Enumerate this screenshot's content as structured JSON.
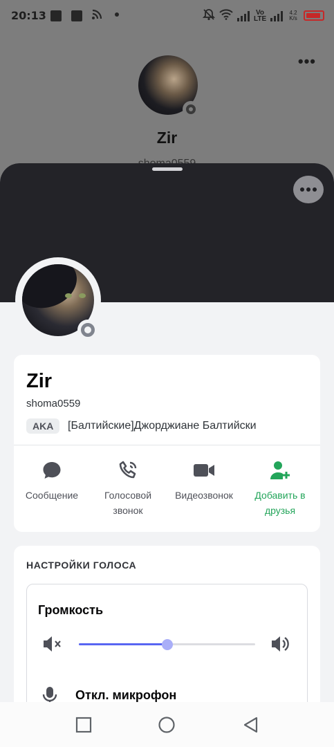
{
  "status_bar": {
    "time": "20:13",
    "network_label": "Vo LTE",
    "speed": "4.2 K/s",
    "icons": [
      "notification-square-icon",
      "notification-square-icon",
      "rss-icon",
      "dot-icon",
      "bell-off-icon",
      "wifi-icon",
      "signal-icon",
      "signal-icon",
      "battery-low-icon"
    ],
    "battery_color": "#c62828"
  },
  "background_profile": {
    "name": "Zir",
    "handle": "shoma0559"
  },
  "profile": {
    "name": "Zir",
    "username": "shoma0559",
    "aka_badge": "AKA",
    "aka_text": "[Балтийские]Джорджиане Балтийски",
    "status": "offline",
    "banner_color": "#232328"
  },
  "actions": [
    {
      "label": "Сообщение",
      "icon": "chat-bubble-icon"
    },
    {
      "label": "Голосовой звонок",
      "icon": "phone-call-icon"
    },
    {
      "label": "Видеозвонок",
      "icon": "video-camera-icon"
    },
    {
      "label": "Добавить в друзья",
      "icon": "add-friend-icon",
      "color": "#23a55a"
    }
  ],
  "voice_settings": {
    "section_title": "НАСТРОЙКИ ГОЛОСА",
    "volume_label": "Громкость",
    "volume_value": 0.5,
    "mute_mic_label": "Откл. микрофон"
  },
  "colors": {
    "accent": "#5865f2",
    "green": "#23a55a"
  }
}
